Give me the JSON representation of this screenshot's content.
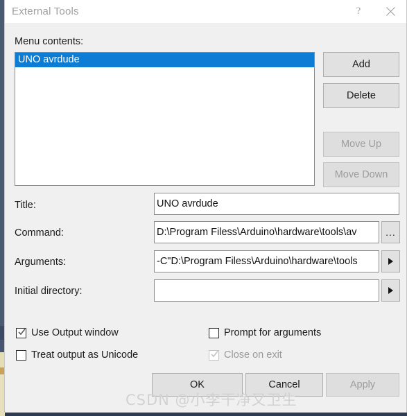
{
  "window": {
    "title": "External Tools",
    "help_icon": "help-question-icon",
    "close_icon": "close-icon",
    "help_glyph": "?"
  },
  "menu_contents": {
    "label": "Menu contents:",
    "items": [
      {
        "label": "UNO avrdude",
        "selected": true
      }
    ],
    "selection_color": "#0c7cd5"
  },
  "list_buttons": [
    {
      "name": "add-button",
      "label": "Add",
      "enabled": true
    },
    {
      "name": "delete-button",
      "label": "Delete",
      "enabled": true
    },
    {
      "name": "move-up-button",
      "label": "Move Up",
      "enabled": false
    },
    {
      "name": "move-down-button",
      "label": "Move Down",
      "enabled": false
    }
  ],
  "fields": {
    "title": {
      "label": "Title:",
      "value": "UNO avrdude",
      "placeholder": ""
    },
    "command": {
      "label": "Command:",
      "value": "D:\\Program Filess\\Arduino\\hardware\\tools\\av",
      "placeholder": "",
      "browse_label": "...",
      "browse_icon": "ellipsis-icon"
    },
    "arguments": {
      "label": "Arguments:",
      "value": "-C\"D:\\Program Filess\\Arduino\\hardware\\tools",
      "placeholder": "",
      "insert_icon": "triangle-right-icon"
    },
    "initial_directory": {
      "label": "Initial directory:",
      "value": "",
      "placeholder": "",
      "insert_icon": "triangle-right-icon"
    }
  },
  "checkboxes": [
    {
      "name": "use-output-window-checkbox",
      "label": "Use Output window",
      "checked": true,
      "enabled": true
    },
    {
      "name": "prompt-for-arguments-checkbox",
      "label": "Prompt for arguments",
      "checked": false,
      "enabled": true
    },
    {
      "name": "treat-output-as-unicode-checkbox",
      "label": "Treat output as Unicode",
      "checked": false,
      "enabled": true
    },
    {
      "name": "close-on-exit-checkbox",
      "label": "Close on exit",
      "checked": true,
      "enabled": false
    }
  ],
  "dialog_buttons": [
    {
      "name": "ok-button",
      "label": "OK",
      "enabled": true
    },
    {
      "name": "cancel-button",
      "label": "Cancel",
      "enabled": true
    },
    {
      "name": "apply-button",
      "label": "Apply",
      "enabled": false
    }
  ],
  "watermark": {
    "text": "CSDN @小李干净又卫生"
  }
}
